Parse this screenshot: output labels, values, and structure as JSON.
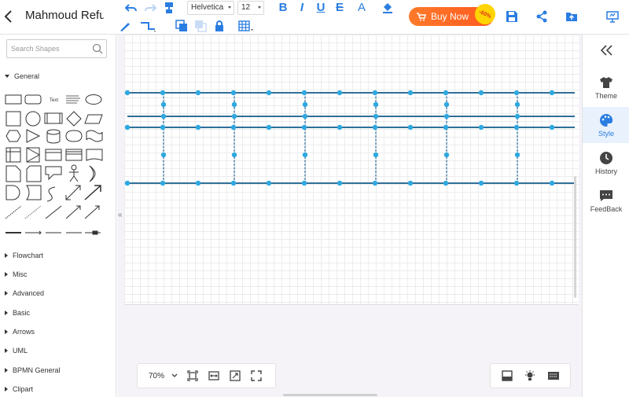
{
  "toolbar": {
    "doc_title": "Mahmoud Refug",
    "font_family": "Helvetica",
    "font_size": "12",
    "buy_now_label": "Buy Now",
    "discount_badge": "-60%",
    "accent": "#2a7de1"
  },
  "sidebar": {
    "search_placeholder": "Search Shapes",
    "expanded_category": "General",
    "categories": [
      "Flowchart",
      "Misc",
      "Advanced",
      "Basic",
      "Arrows",
      "UML",
      "BPMN General",
      "Clipart"
    ],
    "text_shape_label": "Text"
  },
  "canvas": {
    "zoom": "70%"
  },
  "right_panel": {
    "items": [
      {
        "label": "Theme",
        "icon": "shirt-icon"
      },
      {
        "label": "Style",
        "icon": "palette-icon"
      },
      {
        "label": "History",
        "icon": "clock-icon"
      },
      {
        "label": "FeedBack",
        "icon": "chat-icon"
      }
    ],
    "active": "Style"
  }
}
